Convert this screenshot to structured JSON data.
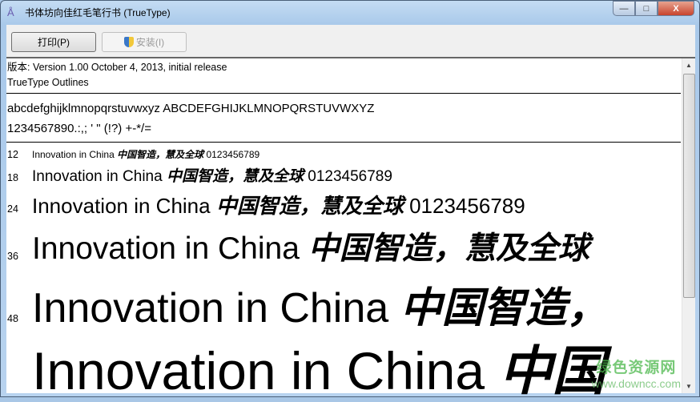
{
  "window": {
    "title": "书体坊向佳红毛笔行书 (TrueType)",
    "minimize": "—",
    "maximize": "□",
    "close": "X"
  },
  "toolbar": {
    "print_label": "打印(P)",
    "install_label": "安装(I)"
  },
  "info": {
    "version": "版本: Version 1.00 October 4, 2013, initial release",
    "outlines": "TrueType Outlines"
  },
  "charset": {
    "line1": "abcdefghijklmnopqrstuvwxyz ABCDEFGHIJKLMNOPQRSTUVWXYZ",
    "line2": "1234567890.:,; ' \" (!?) +-*/="
  },
  "samples": [
    {
      "size": "12",
      "latin": "Innovation in China",
      "cjk": "中国智造，慧及全球",
      "digits": "0123456789"
    },
    {
      "size": "18",
      "latin": "Innovation in China",
      "cjk": "中国智造，慧及全球",
      "digits": "0123456789"
    },
    {
      "size": "24",
      "latin": "Innovation in China",
      "cjk": "中国智造，慧及全球",
      "digits": "0123456789"
    },
    {
      "size": "36",
      "latin": "Innovation in China",
      "cjk": "中国智造，慧及全球",
      "digits": ""
    },
    {
      "size": "48",
      "latin": "Innovation in China",
      "cjk": "中国智造，",
      "digits": ""
    },
    {
      "size": "",
      "latin": "Innovation in China",
      "cjk": "中国",
      "digits": ""
    }
  ],
  "watermark": {
    "name": "绿色资源网",
    "url": "www.downcc.com"
  }
}
